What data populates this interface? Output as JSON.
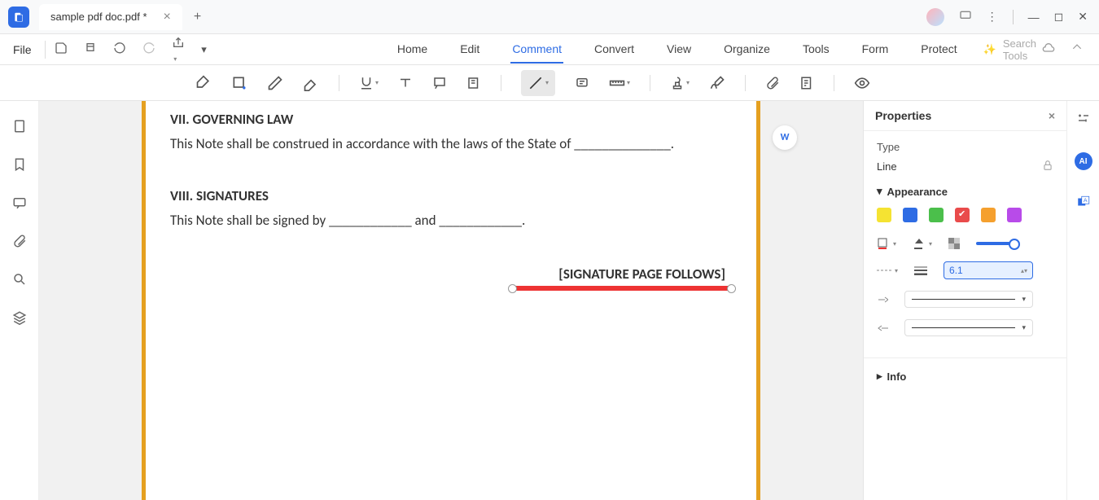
{
  "titlebar": {
    "tab_name": "sample pdf doc.pdf *"
  },
  "menus": {
    "file": "File",
    "home": "Home",
    "edit": "Edit",
    "comment": "Comment",
    "convert": "Convert",
    "view": "View",
    "organize": "Organize",
    "tools": "Tools",
    "form": "Form",
    "protect": "Protect",
    "search_placeholder": "Search Tools"
  },
  "document": {
    "section7_title": "VII. GOVERNING LAW",
    "section7_body": "This Note shall be construed in accordance with the laws of the State of ______________.",
    "section8_title": "VIII. SIGNATURES",
    "section8_body": "This Note shall be signed by ____________ and ____________.",
    "signature_follows": "[SIGNATURE PAGE FOLLOWS]"
  },
  "properties": {
    "title": "Properties",
    "type_label": "Type",
    "type_value": "Line",
    "appearance_label": "Appearance",
    "thickness_value": "6.1",
    "info_label": "Info",
    "swatches": {
      "yellow": "#f5e332",
      "blue": "#2e6ce4",
      "green": "#4bbf4b",
      "red": "#e94b4b",
      "orange": "#f5a02e",
      "purple": "#b84be9"
    }
  }
}
